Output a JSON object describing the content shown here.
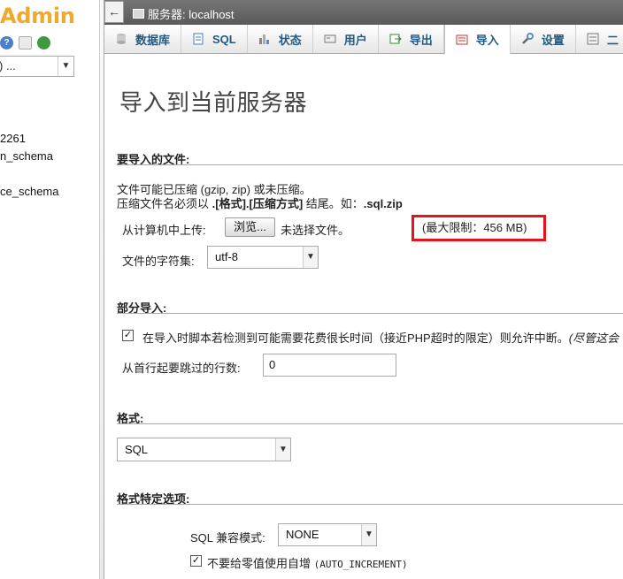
{
  "nav": {
    "logo": "Admin",
    "db_select_value": ") ...",
    "items": [
      "2261",
      "n_schema",
      "ce_schema"
    ]
  },
  "topbar": {
    "back_icon": "←",
    "server_label": "服务器: localhost"
  },
  "tabs": [
    {
      "label": "数据库",
      "icon": "database-icon"
    },
    {
      "label": "SQL",
      "icon": "sql-icon"
    },
    {
      "label": "状态",
      "icon": "status-icon"
    },
    {
      "label": "用户",
      "icon": "users-icon"
    },
    {
      "label": "导出",
      "icon": "export-icon"
    },
    {
      "label": "导入",
      "icon": "import-icon",
      "active": true
    },
    {
      "label": "设置",
      "icon": "settings-icon"
    },
    {
      "label": "二",
      "icon": "binlog-icon"
    }
  ],
  "main": {
    "title": "导入到当前服务器",
    "file_section": {
      "legend": "要导入的文件:",
      "line1": "文件可能已压缩 (gzip, zip) 或未压缩。",
      "line2_prefix": "压缩文件名必须以 ",
      "line2_bold": ".[格式].[压缩方式]",
      "line2_mid": " 结尾。如：",
      "line2_example": ".sql.zip",
      "upload_label": "从计算机中上传:",
      "browse_button": "浏览...",
      "no_file": "未选择文件。",
      "max_limit": "(最大限制：456 MB)",
      "charset_label": "文件的字符集:",
      "charset_value": "utf-8"
    },
    "partial_section": {
      "legend": "部分导入:",
      "interrupt_label": "在导入时脚本若检测到可能需要花费很长时间（接近PHP超时的限定）则允许中断。",
      "interrupt_note": "(尽管这会",
      "interrupt_checked": true,
      "skip_label": "从首行起要跳过的行数:",
      "skip_value": "0"
    },
    "format_section": {
      "legend": "格式:",
      "format_value": "SQL"
    },
    "format_options": {
      "legend": "格式特定选项:",
      "compat_label": "SQL 兼容模式:",
      "compat_value": "NONE",
      "auto_inc_label": "不要给零值使用自增",
      "auto_inc_code": "(AUTO_INCREMENT)",
      "auto_inc_checked": true
    }
  },
  "colors": {
    "accent_logo": "#f2a92a",
    "tab_text": "#235a81",
    "highlight": "#e8131a"
  }
}
